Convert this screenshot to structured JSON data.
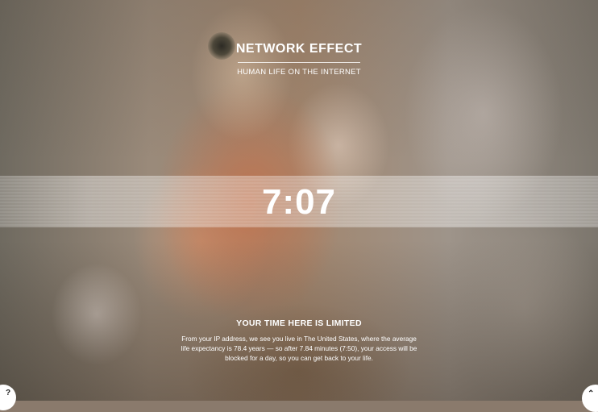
{
  "header": {
    "title": "NETWORK EFFECT",
    "subtitle": "HUMAN LIFE ON THE INTERNET"
  },
  "timer": {
    "display": "7:07"
  },
  "notice": {
    "heading": "YOUR TIME HERE IS LIMITED",
    "body": "From your IP address, we see you live in The United States, where the average life expectancy is 78.4 years — so after 7.84 minutes (7:50), your access will be blocked for a day, so you can get back to your life."
  },
  "controls": {
    "help_label": "?",
    "corner_icon": "corner-menu-icon"
  }
}
